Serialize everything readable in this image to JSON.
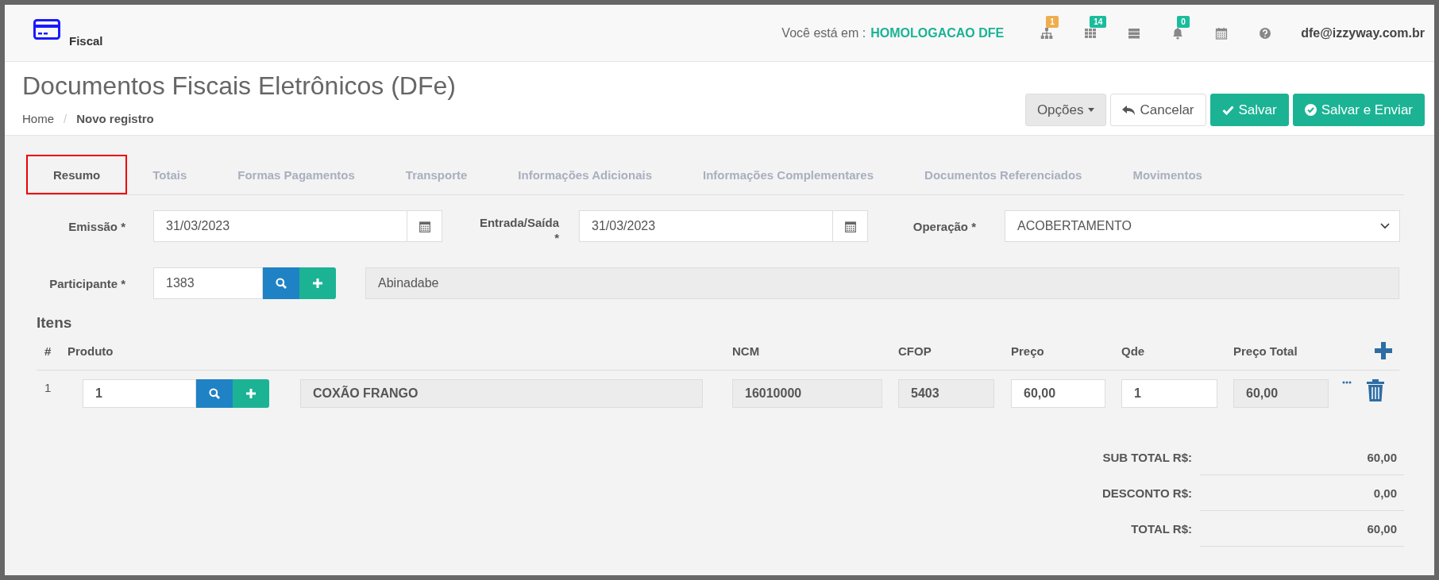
{
  "topbar": {
    "app_name": "Fiscal",
    "env_label": "Você está em :",
    "env_value": "HOMOLOGACAO DFE",
    "icons": [
      {
        "kind": "sitemap",
        "badge": "1",
        "color": "#f0ad4e"
      },
      {
        "kind": "grid",
        "badge": "14",
        "color": "#1abc9c"
      },
      {
        "kind": "server"
      },
      {
        "kind": "bell",
        "badge": "0",
        "color": "#1abc9c"
      },
      {
        "kind": "calendar"
      },
      {
        "kind": "question"
      }
    ],
    "user_email": "dfe@izzyway.com.br"
  },
  "header": {
    "title": "Documentos Fiscais Eletrônicos (DFe)",
    "breadcrumb": [
      "Home",
      "Novo registro"
    ],
    "breadcrumb_separator": "/",
    "buttons": [
      {
        "kind": "dropdown",
        "label": "Opções"
      },
      {
        "kind": "cancel",
        "label": "Cancelar"
      },
      {
        "kind": "save",
        "label": "Salvar"
      },
      {
        "kind": "send",
        "label": "Salvar e Enviar"
      }
    ]
  },
  "tabs": [
    {
      "label": "Resumo",
      "selected": true
    },
    {
      "label": "Totais",
      "selected": false
    },
    {
      "label": "Formas Pagamentos",
      "selected": false
    },
    {
      "label": "Transporte",
      "selected": false
    },
    {
      "label": "Informações Adicionais",
      "selected": false
    },
    {
      "label": "Informações Complementares",
      "selected": false
    },
    {
      "label": "Documentos Referenciados",
      "selected": false
    },
    {
      "label": "Movimentos",
      "selected": false
    }
  ],
  "form": {
    "emissao": {
      "label": "Emissão *",
      "value": "31/03/2023"
    },
    "entrada_saida": {
      "label": "Entrada/Saída *",
      "value": "31/03/2023"
    },
    "operacao": {
      "label": "Operação *",
      "value": "ACOBERTAMENTO"
    },
    "participante": {
      "label": "Participante *",
      "code": "1383",
      "name": "Abinadabe"
    }
  },
  "items": {
    "title": "Itens",
    "columns": [
      "#",
      "Produto",
      "NCM",
      "CFOP",
      "Preço",
      "Qde",
      "Preço Total"
    ],
    "rows": [
      {
        "index": "1",
        "product_code": "1",
        "description": "COXÃO FRANGO",
        "ncm": "16010000",
        "cfop": "5403",
        "price": "60,00",
        "quantity": "1",
        "total": "60,00"
      }
    ]
  },
  "totals": [
    {
      "label": "SUB TOTAL R$:",
      "value": "60,00"
    },
    {
      "label": "DESCONTO R$:",
      "value": "0,00"
    },
    {
      "label": "TOTAL R$:",
      "value": "60,00"
    }
  ]
}
